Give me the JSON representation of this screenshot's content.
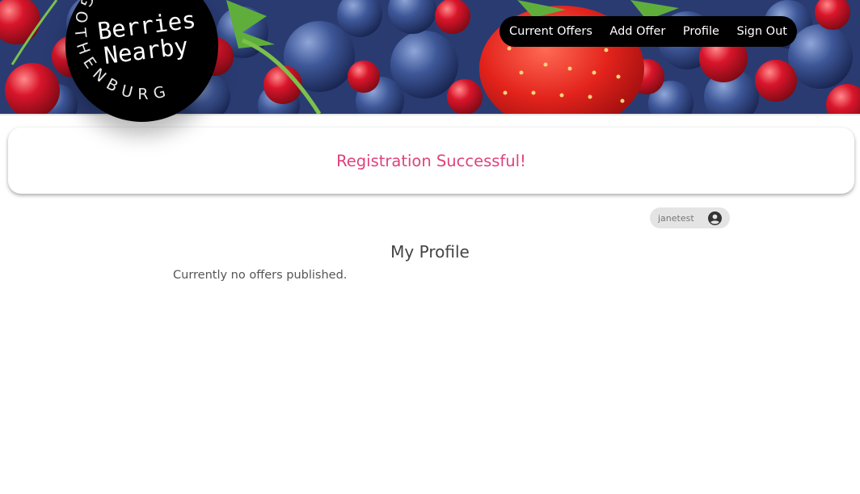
{
  "brand": {
    "line1": "Berries",
    "line2": "Nearby",
    "ring_text": "GOTHENBURG"
  },
  "nav": {
    "items": [
      {
        "label": "Current Offers"
      },
      {
        "label": "Add Offer"
      },
      {
        "label": "Profile"
      },
      {
        "label": "Sign Out"
      }
    ]
  },
  "alert": {
    "message": "Registration Successful!"
  },
  "user": {
    "username": "janetest",
    "icon": "user-circle-icon"
  },
  "profile": {
    "title": "My Profile",
    "empty_message": "Currently no offers published."
  },
  "colors": {
    "accent": "#e0417c",
    "nav_bg": "#000000",
    "chip_bg": "#e4e4e4"
  }
}
